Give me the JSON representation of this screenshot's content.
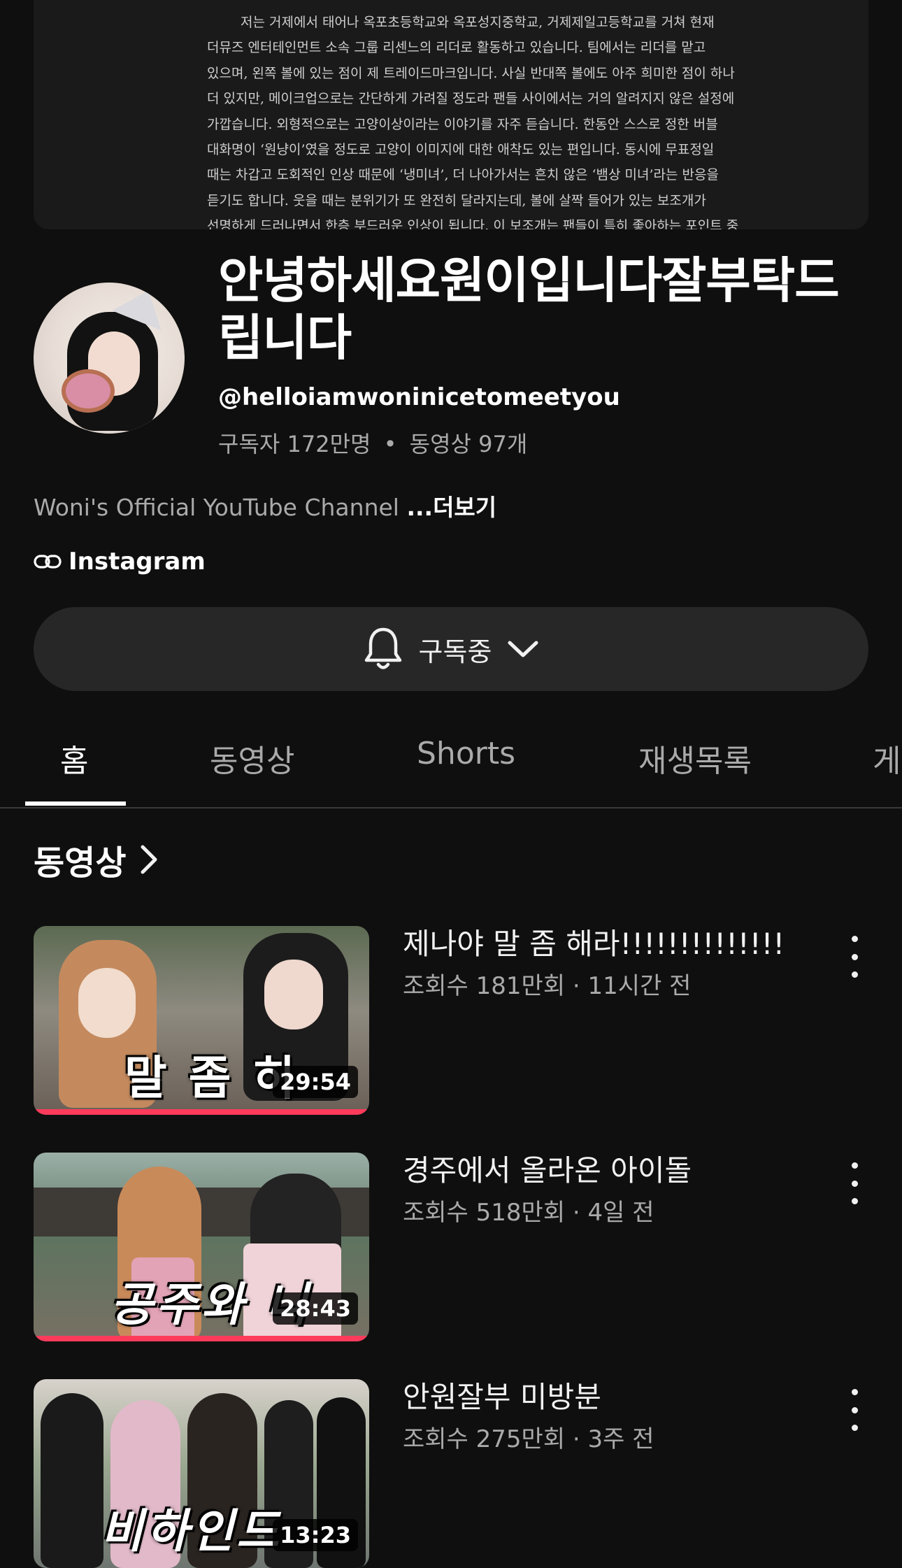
{
  "banner": {
    "lines": [
      "저는 거제에서 태어나 옥포초등학교와 옥포성지중학교, 거제제일고등학교를 거쳐 현재",
      "더뮤즈 엔터테인먼트 소속 그룹 리센느의 리더로 활동하고 있습니다. 팀에서는 리더를 맡고",
      "있으며, 왼쪽 볼에 있는 점이 제 트레이드마크입니다. 사실 반대쪽 볼에도 아주 희미한 점이 하나",
      "더 있지만, 메이크업으로는 간단하게 가려질 정도라 팬들 사이에서는 거의 알려지지 않은 설정에",
      "가깝습니다. 외형적으로는 고양이상이라는 이야기를 자주 듣습니다. 한동안 스스로 정한 버블",
      "대화명이 ‘원냥이’였을 정도로 고양이 이미지에 대한 애착도 있는 편입니다. 동시에 무표정일",
      "때는 차갑고 도회적인 인상 때문에 ‘냉미녀’, 더 나아가서는 흔치 않은 ‘뱀상 미녀’라는 반응을",
      "듣기도 합니다. 웃을 때는 분위기가 또 완전히 달라지는데, 볼에 살짝 들어가 있는 보조개가",
      "선명하게 드러나면서 한층 부드러운 인상이 됩니다. 이 보조개는 팬들이 특히 좋아하는 포인트 중"
    ]
  },
  "channel": {
    "name": "안녕하세요원이입니다잘부탁드립니다",
    "handle": "@helloiamwoninicetomeetyou",
    "subscribers": "구독자 172만명",
    "separator": "•",
    "video_count": "동영상 97개",
    "description": "Woni's Official YouTube Channel",
    "more_label": "...더보기",
    "link_label": "Instagram",
    "subscribe_label": "구독중"
  },
  "tabs": [
    "홈",
    "동영상",
    "Shorts",
    "재생목록",
    "게"
  ],
  "section": {
    "title": "동영상"
  },
  "videos": [
    {
      "title": "제나야 말 좀 해라!!!!!!!!!!!!!!",
      "meta": "조회수 181만회 · 11시간 전",
      "duration": "29:54",
      "caption": "말 좀 히"
    },
    {
      "title": "경주에서 올라온 아이돌",
      "meta": "조회수 518만회 · 4일 전",
      "duration": "28:43",
      "caption": "공주와 니"
    },
    {
      "title": "안원잘부 미방분",
      "meta": "조회수 275만회 · 3주 전",
      "duration": "13:23",
      "caption": "비하인드"
    }
  ],
  "colors": {
    "background": "#0f0f0f",
    "surface": "#272727",
    "progress": "#ff3b5c",
    "secondary_text": "#aaaaaa"
  },
  "icons": [
    "bell-icon",
    "chevron-down-icon",
    "link-icon",
    "chevron-right-icon",
    "more-vertical-icon"
  ]
}
